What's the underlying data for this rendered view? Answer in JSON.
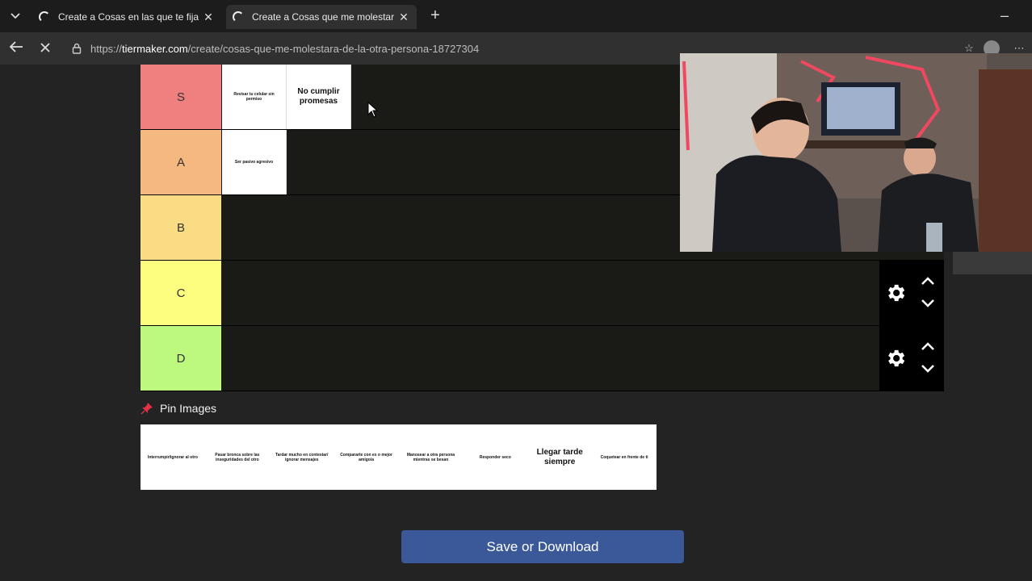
{
  "browser": {
    "tabs": [
      {
        "title": "Create a Cosas en las que te fijas e"
      },
      {
        "title": "Create a Cosas que me molestarla"
      }
    ],
    "url_prefix": "https://",
    "url_domain": "tiermaker.com",
    "url_path": "/create/cosas-que-me-molestara-de-la-otra-persona-18727304"
  },
  "tiers": [
    {
      "label": "S",
      "color": "#f07f80",
      "items": [
        "Revisar tu celular sin permiso",
        "No cumplir promesas"
      ]
    },
    {
      "label": "A",
      "color": "#f6b881",
      "items": [
        "Ser pasivo agresivo"
      ]
    },
    {
      "label": "B",
      "color": "#f9dc83",
      "items": []
    },
    {
      "label": "C",
      "color": "#fdfd7f",
      "items": []
    },
    {
      "label": "D",
      "color": "#bef97f",
      "items": []
    }
  ],
  "pin": {
    "title": "Pin Images",
    "items": [
      "Interrumpir/ignorar al otro",
      "Pasar bronca sobre las inseguridades del otro",
      "Tardar mucho en contestar/ ignorar mensajes",
      "Compararte con ex o mejor amigo/a",
      "Manosear a otra persona mientras se besan",
      "Responder seco",
      "Llegar tarde siempre",
      "Coquetear en frente de ti"
    ]
  },
  "save_label": "Save or Download",
  "colors": {
    "save_button": "#3b5998",
    "tier_bg": "#1a1a17"
  }
}
